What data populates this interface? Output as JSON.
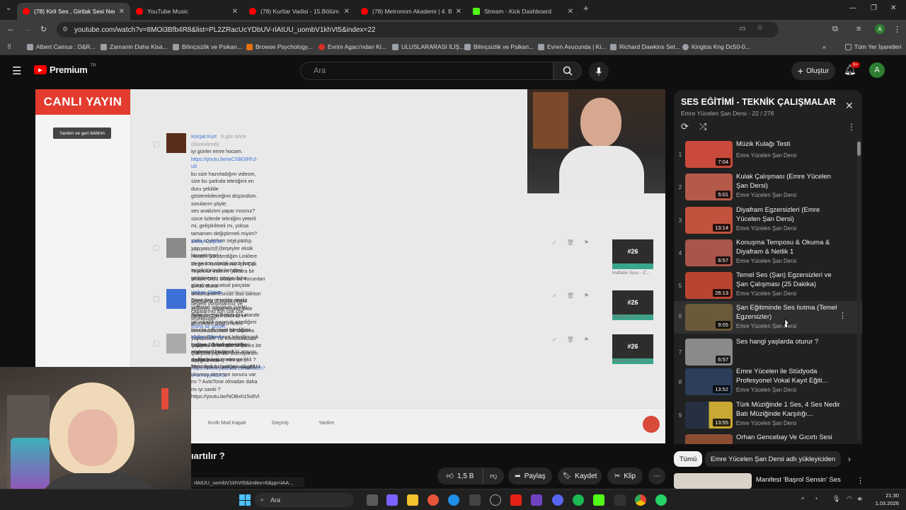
{
  "tabs": [
    {
      "title": "(78) Kirli Ses , Girtlak Sesi Nedir",
      "active": true,
      "color": "#ff0000"
    },
    {
      "title": "YouTube Music",
      "active": false,
      "color": "#ff0000"
    },
    {
      "title": "(78) Kurtlar Vadisi - 15.Bölüm |",
      "active": false,
      "color": "#ff0000"
    },
    {
      "title": "(78) Metronom Akademi | 4. Bö",
      "active": false,
      "color": "#ff0000"
    },
    {
      "title": "Stream - Kick Dashboard",
      "active": false,
      "color": "#53fc18"
    }
  ],
  "url": "youtube.com/watch?v=8MOi3Bfb4R8&list=PL2ZRacUcYDbUV-rlAtUU_uombV1khVt5&index=22",
  "bookmarks": [
    "Albert Camus : D&R...",
    "Zamanin Daha Kisa...",
    "Bilinçsizlik ve Psikan...",
    "Browse Psychology...",
    "Evrim Agacı'ndan Ki...",
    "ULUSLARARASI İLİŞ...",
    "Bilinçsizlik ve Psikan...",
    "Evren Avucunda | Ki...",
    "Richard Dawkins Set...",
    "Kingtos Kng Dc50-0...",
    "Tüm Yer İşaretleri"
  ],
  "yt": {
    "logo": "Premium",
    "logo_sup": "TR",
    "search_placeholder": "Ara",
    "create_label": "Oluştur",
    "notif_count": "9+",
    "avatar_letter": "A"
  },
  "video": {
    "live_label": "CANLI YAYIN",
    "help_label": "Yardım ve geri bildirim",
    "comments": [
      {
        "name": "Kürşat Kurt",
        "time": "6 gün önce (düzenlendi)",
        "lines": [
          "iyi günler emre hocam.",
          "https://youtu.be/wCSBOIRhJ-u0",
          "bu size hazırladığım videom, size bu şarkıda tekniğimi en duru şekilde gösterebileceğimi düşündüm.",
          "     sorularım şöyle;",
          "ses analizimi yapar mısınız?",
          "sizce tizlerde tekniğim yeterli mi, geliştirilmeli mi, yoksa tamamen değiştirmeli miyim?",
          "şarkı söylerken neyi yanlış yapıyorum? (birşeyler eksik hissettiriyor)",
          "ve en son olarak sizce hangi müzik türünde kendimi geliştirirsem ortaya daha güzel ve sanatsal parçalar ortaya çıkar?",
          "",
          "değerli yorumlarınız ve çabalarınız için çok çok teşekkürler.",
          "Daha az göster"
        ]
      },
      {
        "name": "Kutay Coşkun",
        "time": "6 gün önce (düzenlendi)",
        "lines": [
          "Hocam Gönderdiğim Linklere  Degerli Yorumlarınız İçin Çok Teşekkür ederim  :)Ekstra bir Motive Oldu Sizden bu Yorumları almak  Bana",
          "Ses incelemesinde Bas bariton demiştiniz :) Bunun Biraz acılımını yaparmısınız Bide Nefesim Zayıf dediniz ve gercekten Dogru   nefes",
          "konusunda nasıl bir  calısma yapabilirim Tiz Konusundada Çalışma Önerimisiniz Yanlıs bir Çalışma yapmak istemiyorum Saygılarımla :)",
          "https://www.youtube.com/watch?v=lxY6yyRS76c"
        ]
      },
      {
        "name": "Volkan Ozkan",
        "time": "6 gün önce",
        "lines": [
          "Emre bey genelde analiz videoları istiyorum çünkü daha önemli benim için Hande ye vokallik yapmak istediğimi onunla çalışmak istediğimi",
          "söylemiştim bana tekniğin çok sağlam olması gerektiğini söylemişti birde siz açıklarmısınız neler gerekli ? Elektronik bir parçayı akustik",
          "okumuş sizce ton sorunu var mı ? AutoTone olmadan daha mı iyi sanki ? https://youtu.be/NOBxh15v8VI"
        ]
      },
      {
        "name": "Hakan Türmer",
        "time": "6 gün önce",
        "lines": [
          "hocam 2 3 haftadır video atamıyordum şimdi bi atayım dedim bi bakar mısınız :) https://youtu.be/KbHoo0jgE1M"
        ]
      }
    ],
    "thumb_label": "#26",
    "thumb_caption": "Haftalık Soru - C...",
    "bottom_items": [
      "Kırıtlı Mod Kapalı",
      "Geçmiş",
      "Yardım"
    ]
  },
  "below": {
    "title_fragment": "ıartılır ?",
    "like_count": "1,5 B",
    "share_label": "Paylaş",
    "save_label": "Kaydet",
    "clip_label": "Klip",
    "status_url": "rlAtUU_uombV1khVt5&index=6&pp=iAA..."
  },
  "playlist": {
    "title": "SES EĞİTİMİ - TEKNİK ÇALIŞMALAR",
    "subtitle": "Emre Yücelen Şan Dersi - 22 / 278",
    "items": [
      {
        "idx": "1",
        "title": "Müzik Kulağı Testi",
        "channel": "Emre Yücelen Şan Dersi",
        "dur": "7:04",
        "color": "#c94a3d"
      },
      {
        "idx": "2",
        "title": "Kulak Çalışması (Emre Yücelen Şan Dersi)",
        "channel": "Emre Yücelen Şan Dersi",
        "dur": "5:01",
        "color": "#b55a49"
      },
      {
        "idx": "3",
        "title": "Diyafram Egzersizleri (Emre Yücelen Şan Dersi)",
        "channel": "Emre Yücelen Şan Dersi",
        "dur": "13:14",
        "color": "#c2513e"
      },
      {
        "idx": "4",
        "title": "Konuşma Temposu & Okuma & Diyafram & Netlik 1",
        "channel": "Emre Yücelen Şan Dersi",
        "dur": "6:57",
        "color": "#a8554a"
      },
      {
        "idx": "5",
        "title": "Temel Ses (Şan) Egzersizleri ve Şan Çalışması (25 Dakika)",
        "channel": "Emre Yücelen Şan Dersi",
        "dur": "26:13",
        "color": "#b8452f"
      },
      {
        "idx": "6",
        "title": "Şan Eğitiminde Ses Isıtma (Temel Egzersizler)",
        "channel": "Emre Yücelen Şan Dersi",
        "dur": "9:05",
        "color": "#6b5a3a"
      },
      {
        "idx": "7",
        "title": "Ses hangi yaşlarda oturur ?",
        "channel": "Emre Yücelen Şan Dersi",
        "dur": "6:57",
        "color": "#8a8a8a"
      },
      {
        "idx": "8",
        "title": "Emre Yücelen ile Stüdyoda Profesyonel Vokal Kayıt Eğiti...",
        "channel": "Emre Yücelen Şan Dersi",
        "dur": "13:52",
        "color": "#2c3e5c"
      },
      {
        "idx": "9",
        "title": "Türk Müziğinde 1 Ses, 4 Ses Nedir Batı Müziğinde Karşılığı...",
        "channel": "Emre Yücelen Şan Dersi",
        "dur": "13:55",
        "color": "#c9a834"
      },
      {
        "idx": "10",
        "title": "Orhan Gencebay Ve Gıcırtı Sesi",
        "channel": "Emre Yücelen Şan Dersi",
        "dur": "",
        "color": "#8b4c34"
      }
    ]
  },
  "chips": {
    "all": "Tümü",
    "uploader": "Emre Yücelen Şan Dersi adlı yükleyiciden"
  },
  "next_video": "Manifest 'Başrol Sensin' Ses",
  "taskbar": {
    "search": "Ara",
    "time": "21:30",
    "date": "1.03.2026"
  }
}
